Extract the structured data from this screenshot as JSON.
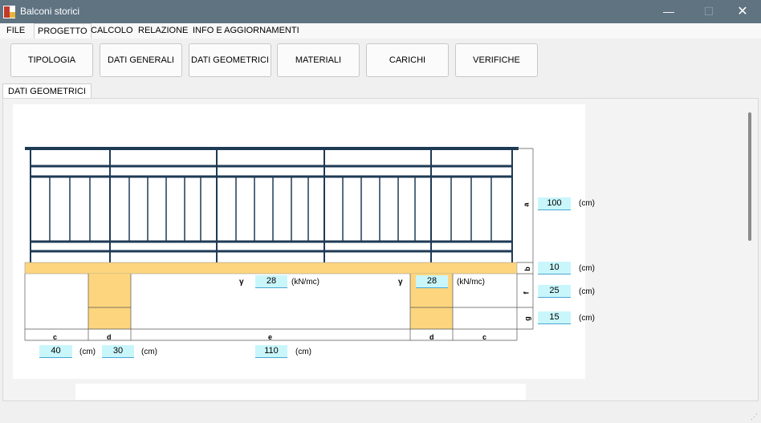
{
  "window": {
    "title": "Balconi storici",
    "minimize": "—",
    "maximize": "☐",
    "close": "✕"
  },
  "menu": [
    "FILE",
    "PROGETTO",
    "CALCOLO",
    "RELAZIONE",
    "INFO E AGGIORNAMENTI"
  ],
  "toolbar": [
    "TIPOLOGIA",
    "DATI GENERALI",
    "DATI GEOMETRICI",
    "MATERIALI",
    "CARICHI",
    "VERIFICHE"
  ],
  "tab": "DATI GEOMETRICI",
  "colors": {
    "rail": "#1e3a55",
    "slab": "#fcd57e",
    "field": "#c9f6fb"
  },
  "dims": {
    "a": {
      "letter": "a",
      "value": "100",
      "unit": "(cm)"
    },
    "b": {
      "letter": "b",
      "value": "10",
      "unit": "(cm)"
    },
    "f": {
      "letter": "f",
      "value": "25",
      "unit": "(cm)"
    },
    "g": {
      "letter": "g",
      "value": "15",
      "unit": "(cm)"
    },
    "c": {
      "letter": "c",
      "value": "40",
      "unit": "(cm)"
    },
    "d": {
      "letter": "d",
      "value": "30",
      "unit": "(cm)"
    },
    "e": {
      "letter": "e",
      "value": "110",
      "unit": "(cm)"
    },
    "c_right": "c",
    "d_right": "d"
  },
  "gamma_left": {
    "symbol": "γ",
    "value": "28",
    "unit": "(kN/mc)"
  },
  "gamma_right": {
    "symbol": "γ",
    "value": "28",
    "unit": "(kN/mc)"
  }
}
